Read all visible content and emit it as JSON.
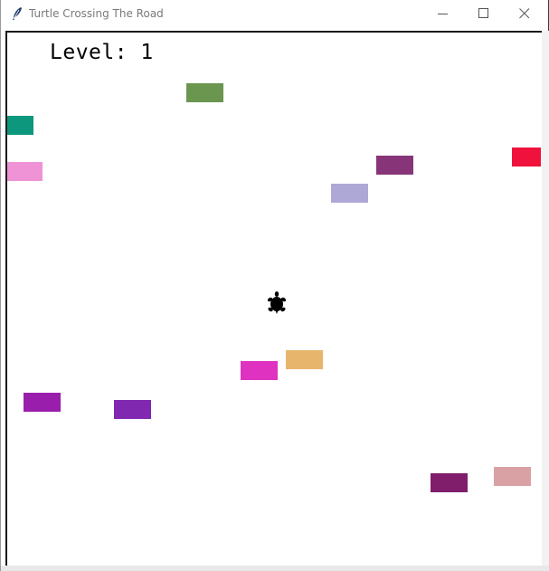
{
  "window": {
    "title": "Turtle Crossing The Road",
    "icon": "feather-icon",
    "controls": [
      "minimize-icon",
      "maximize-icon",
      "close-icon"
    ]
  },
  "hud": {
    "level_text": "Level: 1"
  },
  "game": {
    "player": {
      "icon": "turtle-icon",
      "color": "#000000"
    },
    "cars": [
      {
        "color": "#6a9650"
      },
      {
        "color": "#0d977c"
      },
      {
        "color": "#ef93d6"
      },
      {
        "color": "#873479"
      },
      {
        "color": "#f0123c"
      },
      {
        "color": "#aea8d6"
      },
      {
        "color": "#e7b56c"
      },
      {
        "color": "#df32c0"
      },
      {
        "color": "#9a1eac"
      },
      {
        "color": "#8028b0"
      },
      {
        "color": "#801e6c"
      },
      {
        "color": "#daa1a4"
      }
    ]
  }
}
